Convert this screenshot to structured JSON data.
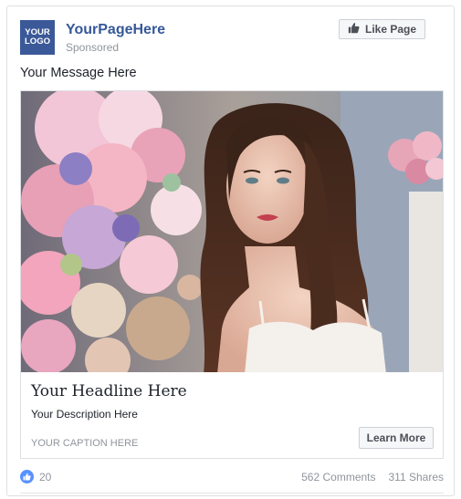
{
  "post": {
    "logo_line1": "YOUR",
    "logo_line2": "LOGO",
    "page_name": "YourPageHere",
    "sponsored": "Sponsored",
    "like_page_label": "Like Page",
    "message": "Your Message Here"
  },
  "link": {
    "headline": "Your Headline Here",
    "description": "Your Description Here",
    "caption": "YOUR CAPTION HERE",
    "cta_label": "Learn More"
  },
  "engagement": {
    "likes": "20",
    "comments": "562 Comments",
    "shares": "311 Shares"
  },
  "icons": {
    "like_page": "thumbs-up-icon",
    "reaction": "like-reaction-icon"
  },
  "colors": {
    "brand_blue": "#3b5998",
    "link_blue": "#365899",
    "like_blue": "#5890ff",
    "muted_gray": "#90949c"
  }
}
